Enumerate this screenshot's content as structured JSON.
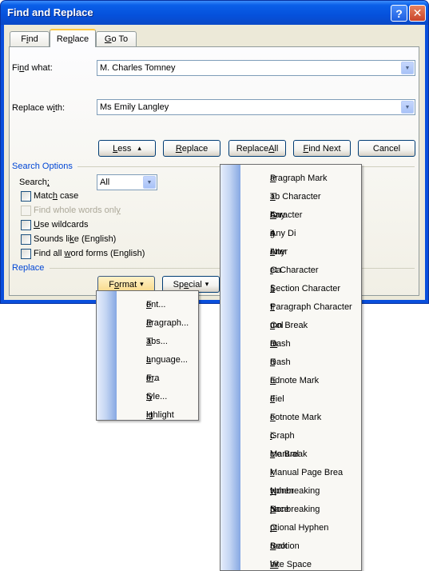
{
  "window": {
    "title": "Find and Replace",
    "help": "?",
    "close": "✕"
  },
  "tabs": [
    {
      "pre": "F",
      "u": "i",
      "post": "nd"
    },
    {
      "pre": "Re",
      "u": "p",
      "post": "lace"
    },
    {
      "pre": "",
      "u": "G",
      "post": "o To"
    }
  ],
  "find_what": {
    "pre": "Fi",
    "u": "n",
    "post": "d what:",
    "value": "M. Charles Tomney"
  },
  "replace_with": {
    "pre": "Replace w",
    "u": "i",
    "post": "th:",
    "value": "Ms Emily Langley"
  },
  "buttons": {
    "less": {
      "pre": "",
      "u": "L",
      "post": "ess",
      "icon": "▴"
    },
    "replace": {
      "pre": "",
      "u": "R",
      "post": "eplace"
    },
    "replace_all": {
      "pre": "Replace ",
      "u": "A",
      "post": "ll"
    },
    "find_next": {
      "pre": "",
      "u": "F",
      "post": "ind Next"
    },
    "cancel": {
      "label": "Cancel"
    }
  },
  "search_options": {
    "heading": "Search Options",
    "search_label": {
      "pre": "Search",
      "u": ";",
      "post": ""
    },
    "search_value": "All",
    "checkboxes": [
      {
        "pre": "Matc",
        "u": "h",
        "post": " case",
        "disabled": false
      },
      {
        "pre": "Find whole words onl",
        "u": "y",
        "post": "",
        "disabled": true
      },
      {
        "pre": "",
        "u": "U",
        "post": "se wildcards",
        "disabled": false
      },
      {
        "pre": "Sounds li",
        "u": "k",
        "post": "e (English)",
        "disabled": false
      },
      {
        "pre": "Find all ",
        "u": "w",
        "post": "ord forms (English)",
        "disabled": false
      }
    ]
  },
  "replace_section": {
    "heading": "Replace",
    "format": {
      "pre": "F",
      "u": "o",
      "post": "rmat",
      "icon": "▾"
    },
    "special": {
      "pre": "Sp",
      "u": "e",
      "post": "cial",
      "icon": "▾"
    }
  },
  "format_menu": [
    {
      "pre": "",
      "u": "F",
      "post": "ont..."
    },
    {
      "pre": "",
      "u": "P",
      "post": "aragraph..."
    },
    {
      "pre": "",
      "u": "T",
      "post": "abs..."
    },
    {
      "pre": "",
      "u": "L",
      "post": "anguage..."
    },
    {
      "pre": "Fra",
      "u": "m",
      "post": "e..."
    },
    {
      "pre": "",
      "u": "S",
      "post": "tyle..."
    },
    {
      "pre": "",
      "u": "H",
      "post": "ighlight"
    }
  ],
  "special_menu": [
    {
      "pre": "",
      "u": "P",
      "post": "aragraph Mark"
    },
    {
      "pre": "",
      "u": "T",
      "post": "ab Character"
    },
    {
      "pre": "Any ",
      "u": "C",
      "post": "haracter"
    },
    {
      "pre": "Any Di",
      "u": "g",
      "post": "it"
    },
    {
      "pre": "Any ",
      "u": "L",
      "post": "etter"
    },
    {
      "pre": "Ca",
      "u": "r",
      "post": "et Character"
    },
    {
      "pre": "",
      "u": "§",
      "post": " Section Character"
    },
    {
      "pre": "",
      "u": "¶",
      "post": " Paragraph Character"
    },
    {
      "pre": "Col",
      "u": "u",
      "post": "mn Break"
    },
    {
      "pre": "E",
      "u": "m",
      "post": " Dash"
    },
    {
      "pre": "E",
      "u": "n",
      "post": " Dash"
    },
    {
      "pre": "",
      "u": "E",
      "post": "ndnote Mark"
    },
    {
      "pre": "Fiel",
      "u": "d",
      "post": ""
    },
    {
      "pre": "",
      "u": "F",
      "post": "ootnote Mark"
    },
    {
      "pre": "Graph",
      "u": "i",
      "post": "c"
    },
    {
      "pre": "Manual ",
      "u": "L",
      "post": "ine Break"
    },
    {
      "pre": "Manual Page Brea",
      "u": "k",
      "post": ""
    },
    {
      "pre": "Nonbreaking ",
      "u": "H",
      "post": "yphen"
    },
    {
      "pre": "Nonbreaking ",
      "u": "S",
      "post": "pace"
    },
    {
      "pre": "",
      "u": "O",
      "post": "ptional Hyphen"
    },
    {
      "pre": "Section ",
      "u": "B",
      "post": "reak"
    },
    {
      "pre": "",
      "u": "W",
      "post": "hite Space"
    }
  ]
}
